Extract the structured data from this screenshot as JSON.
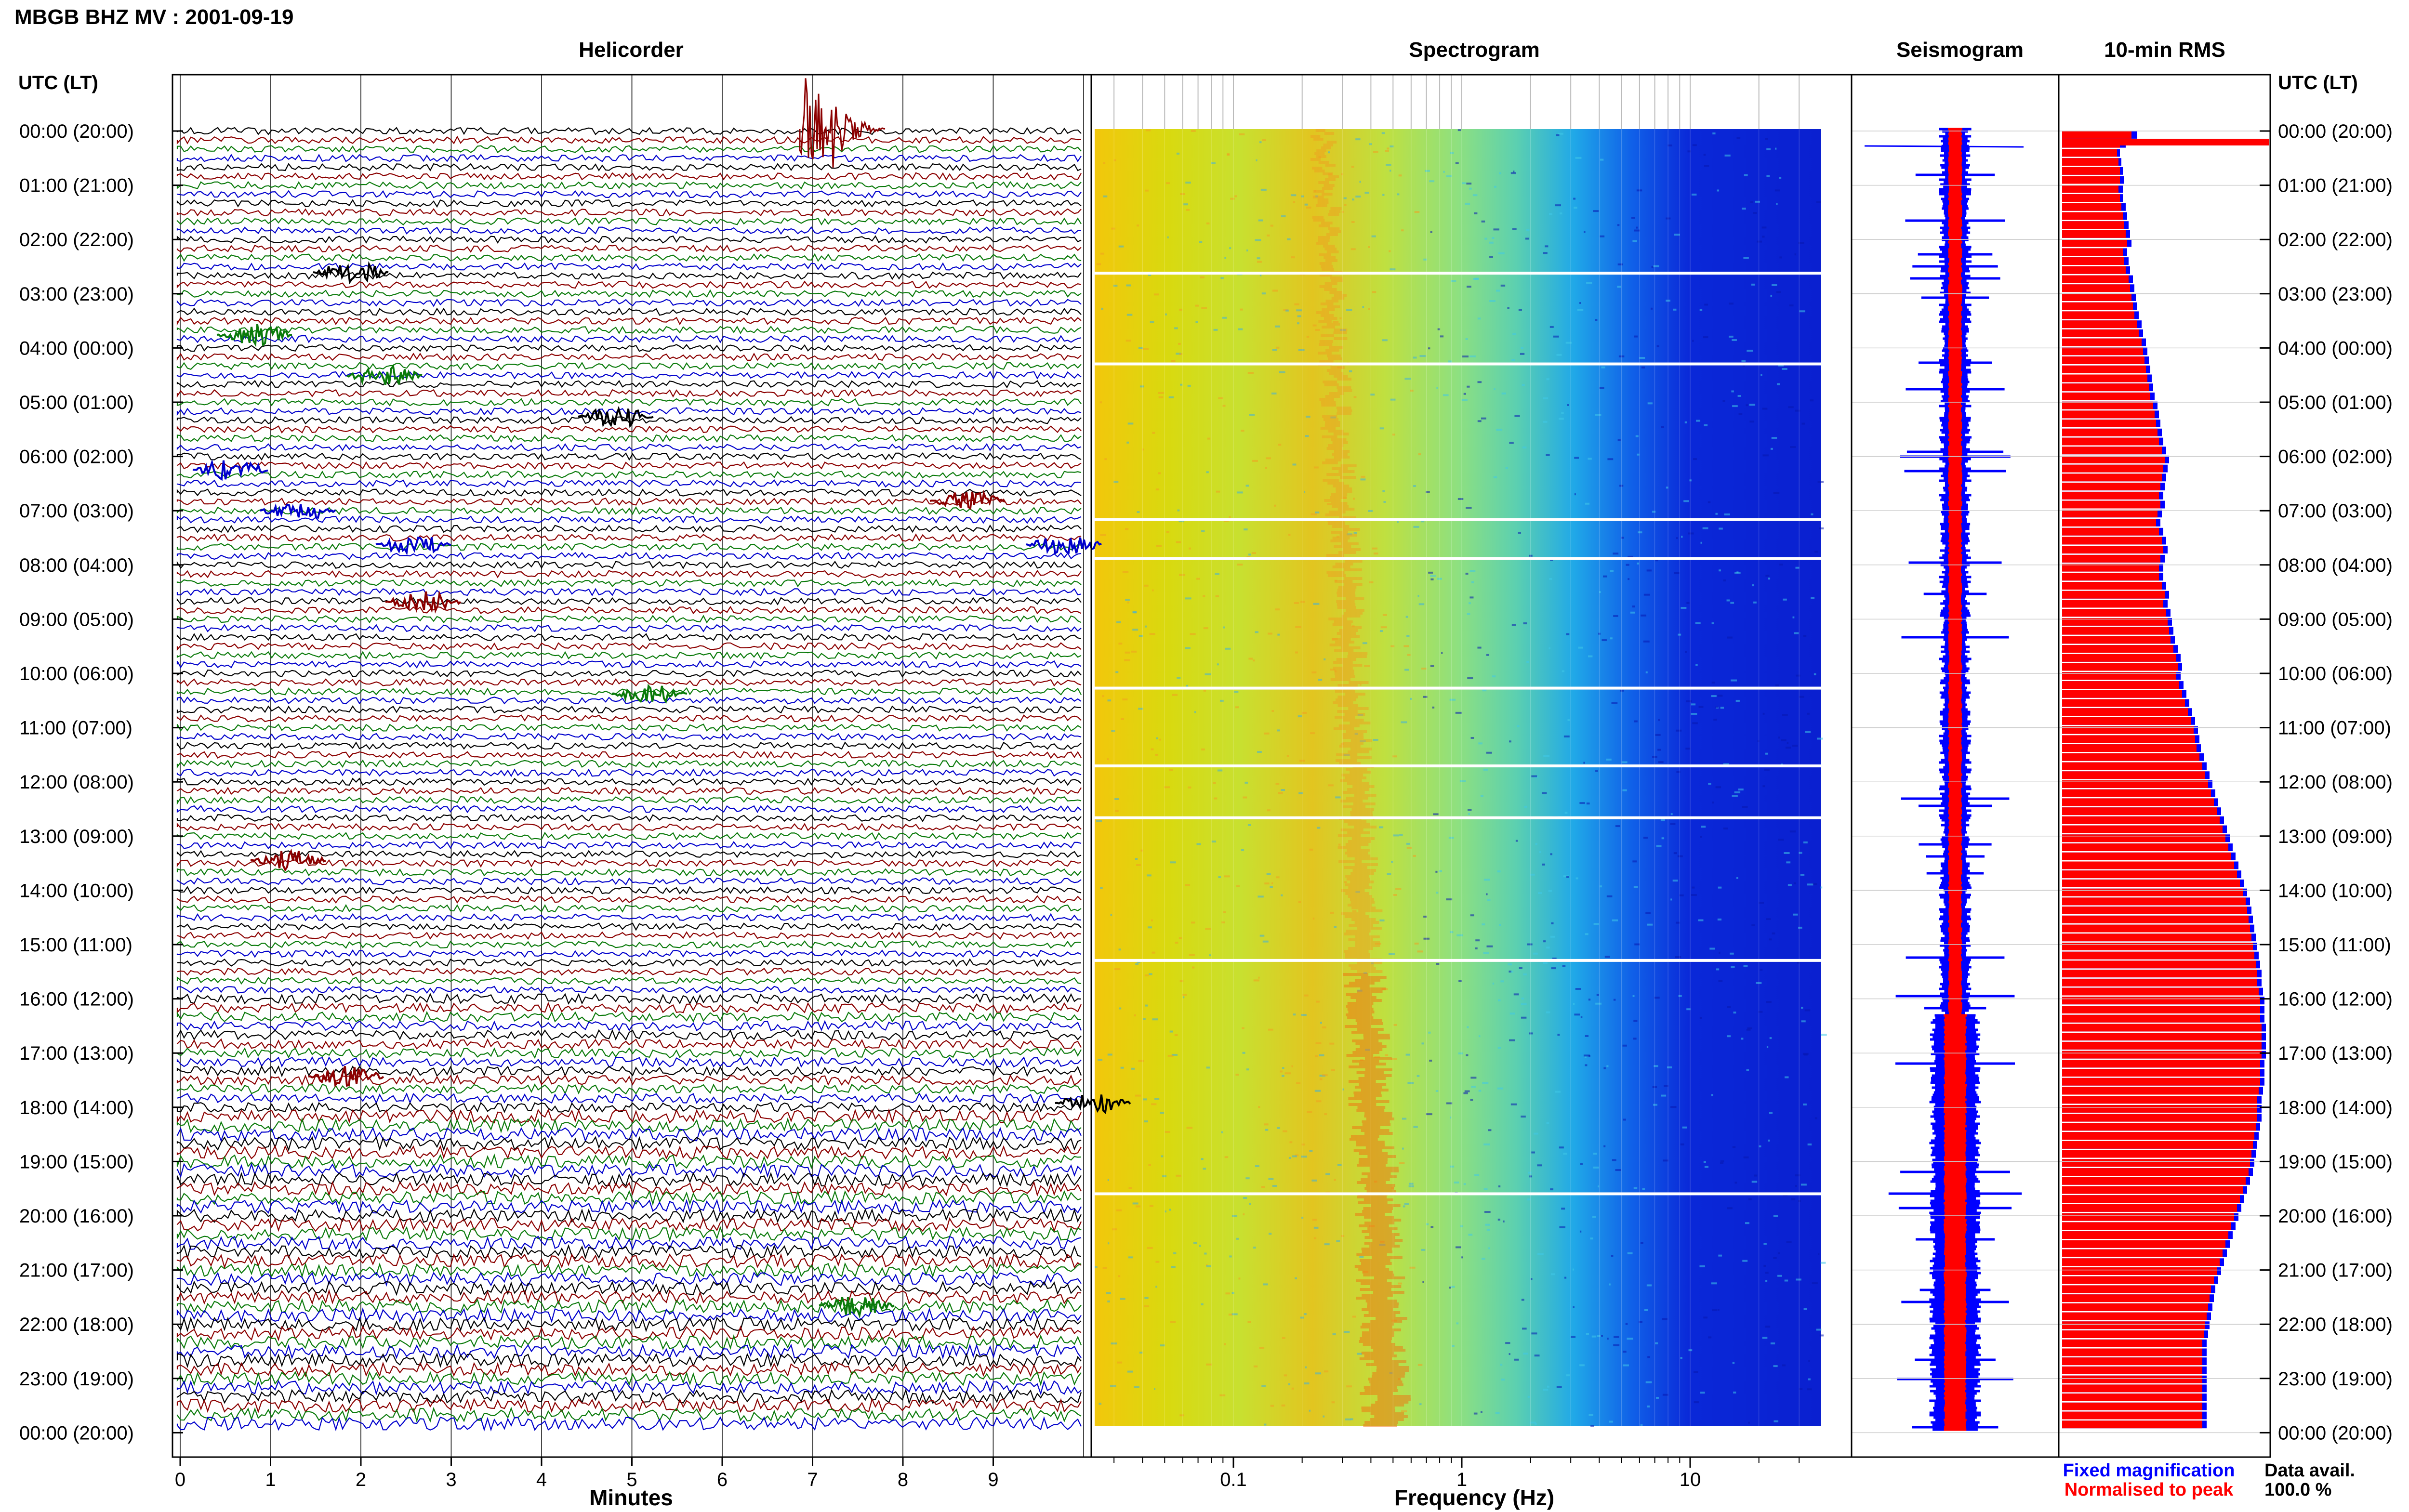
{
  "header": {
    "title": "MBGB BHZ MV : 2001-09-19",
    "left_axis_label": "UTC (LT)",
    "right_axis_label": "UTC (LT)"
  },
  "panels": {
    "helicorder": "Helicorder",
    "spectrogram": "Spectrogram",
    "seismogram": "Seismogram",
    "rms": "10-min RMS"
  },
  "time_labels": [
    "00:00 (20:00)",
    "01:00 (21:00)",
    "02:00 (22:00)",
    "03:00 (23:00)",
    "04:00 (00:00)",
    "05:00 (01:00)",
    "06:00 (02:00)",
    "07:00 (03:00)",
    "08:00 (04:00)",
    "09:00 (05:00)",
    "10:00 (06:00)",
    "11:00 (07:00)",
    "12:00 (08:00)",
    "13:00 (09:00)",
    "14:00 (10:00)",
    "15:00 (11:00)",
    "16:00 (12:00)",
    "17:00 (13:00)",
    "18:00 (14:00)",
    "19:00 (15:00)",
    "20:00 (16:00)",
    "21:00 (17:00)",
    "22:00 (18:00)",
    "23:00 (19:00)",
    "00:00 (20:00)"
  ],
  "helicorder_axis": {
    "xlabel": "Minutes",
    "ticks": [
      "0",
      "1",
      "2",
      "3",
      "4",
      "5",
      "6",
      "7",
      "8",
      "9"
    ],
    "line_colors": [
      "#000000",
      "#8b0000",
      "#0a7a0a",
      "#0000cc"
    ]
  },
  "spectrogram_axis": {
    "xlabel": "Frequency (Hz)",
    "ticks": [
      "0.1",
      "1",
      "10"
    ],
    "scale": "log"
  },
  "legend": {
    "fixed": "Fixed magnification",
    "normalised": "Normalised to peak",
    "fixed_color": "#0000ff",
    "normalised_color": "#ff0000"
  },
  "data_availability": {
    "label": "Data avail.",
    "value": "100.0 %"
  },
  "chart_data": {
    "type": "bar",
    "series": [
      {
        "name": "Fixed magnification",
        "values": [
          0.52,
          0.44,
          0.4,
          0.41,
          0.42,
          0.43,
          0.42,
          0.42,
          0.44,
          0.45,
          0.46,
          0.47,
          0.48,
          0.45,
          0.46,
          0.47,
          0.49,
          0.5,
          0.51,
          0.52,
          0.53,
          0.55,
          0.56,
          0.58,
          0.59,
          0.6,
          0.61,
          0.62,
          0.63,
          0.64,
          0.66,
          0.67,
          0.68,
          0.69,
          0.7,
          0.72,
          0.74,
          0.73,
          0.72,
          0.71,
          0.7,
          0.71,
          0.69,
          0.68,
          0.7,
          0.72,
          0.73,
          0.71,
          0.7,
          0.7,
          0.72,
          0.74,
          0.73,
          0.75,
          0.76,
          0.77,
          0.78,
          0.8,
          0.82,
          0.83,
          0.82,
          0.84,
          0.86,
          0.88,
          0.9,
          0.92,
          0.94,
          0.95,
          0.96,
          0.98,
          1.0,
          1.02,
          1.04,
          1.06,
          1.08,
          1.1,
          1.12,
          1.14,
          1.16,
          1.18,
          1.2,
          1.22,
          1.24,
          1.26,
          1.28,
          1.3,
          1.31,
          1.32,
          1.33,
          1.34,
          1.35,
          1.36,
          1.37,
          1.38,
          1.38,
          1.39,
          1.4,
          1.4,
          1.4,
          1.41,
          1.41,
          1.41,
          1.41,
          1.4,
          1.4,
          1.4,
          1.39,
          1.38,
          1.38,
          1.38,
          1.37,
          1.36,
          1.35,
          1.34,
          1.33,
          1.32,
          1.3,
          1.28,
          1.26,
          1.24,
          1.22,
          1.2,
          1.18,
          1.16,
          1.14,
          1.12,
          1.1,
          1.08,
          1.06,
          1.05,
          1.04,
          1.03,
          1.02,
          1.01,
          1.0,
          1.0,
          1.0,
          1.0,
          1.0,
          1.0,
          1.0,
          1.0,
          1.0,
          1.0
        ]
      },
      {
        "name": "Normalised to peak",
        "values": [
          0.48,
          0.4,
          0.38,
          0.39,
          0.4,
          0.4,
          0.39,
          0.4,
          0.41,
          0.42,
          0.43,
          0.44,
          0.45,
          0.42,
          0.43,
          0.44,
          0.46,
          0.47,
          0.48,
          0.49,
          0.5,
          0.52,
          0.53,
          0.55,
          0.56,
          0.57,
          0.58,
          0.59,
          0.6,
          0.61,
          0.63,
          0.64,
          0.65,
          0.66,
          0.67,
          0.69,
          0.71,
          0.7,
          0.69,
          0.68,
          0.67,
          0.68,
          0.66,
          0.65,
          0.67,
          0.69,
          0.7,
          0.68,
          0.67,
          0.67,
          0.69,
          0.71,
          0.7,
          0.72,
          0.73,
          0.74,
          0.75,
          0.77,
          0.79,
          0.8,
          0.79,
          0.81,
          0.83,
          0.85,
          0.87,
          0.89,
          0.91,
          0.92,
          0.93,
          0.95,
          0.97,
          0.99,
          1.01,
          1.03,
          1.05,
          1.07,
          1.09,
          1.11,
          1.13,
          1.15,
          1.17,
          1.19,
          1.21,
          1.23,
          1.25,
          1.27,
          1.28,
          1.29,
          1.3,
          1.31,
          1.32,
          1.33,
          1.34,
          1.35,
          1.35,
          1.36,
          1.37,
          1.37,
          1.37,
          1.38,
          1.38,
          1.38,
          1.38,
          1.37,
          1.37,
          1.37,
          1.36,
          1.35,
          1.35,
          1.35,
          1.34,
          1.33,
          1.32,
          1.31,
          1.3,
          1.29,
          1.27,
          1.25,
          1.23,
          1.21,
          1.19,
          1.17,
          1.15,
          1.13,
          1.11,
          1.09,
          1.07,
          1.05,
          1.03,
          1.02,
          1.01,
          1.0,
          0.99,
          0.98,
          0.97,
          0.97,
          0.97,
          0.97,
          0.97,
          0.97,
          0.97,
          0.97,
          0.97,
          0.97
        ]
      }
    ]
  }
}
